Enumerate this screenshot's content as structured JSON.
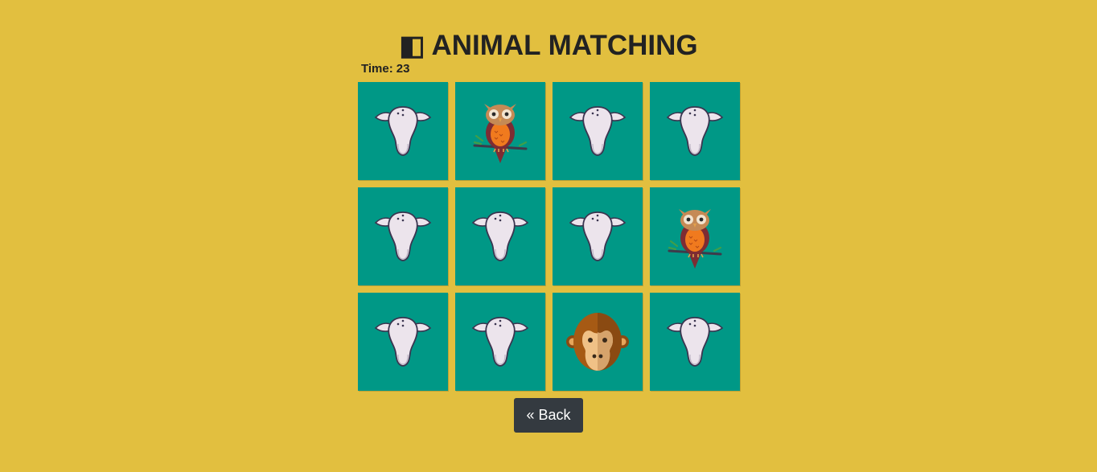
{
  "header": {
    "title": "ANIMAL MATCHING",
    "title_icon": "◧",
    "title_icon_name": "half-square-icon"
  },
  "timer": {
    "label": "Time:",
    "value": "23"
  },
  "board": {
    "columns": 4,
    "rows": 3,
    "card_color": "#009886",
    "cards": [
      {
        "state": "hidden",
        "face": "cow-skull"
      },
      {
        "state": "revealed",
        "face": "owl"
      },
      {
        "state": "hidden",
        "face": "cow-skull"
      },
      {
        "state": "hidden",
        "face": "cow-skull"
      },
      {
        "state": "hidden",
        "face": "cow-skull"
      },
      {
        "state": "hidden",
        "face": "cow-skull"
      },
      {
        "state": "hidden",
        "face": "cow-skull"
      },
      {
        "state": "revealed",
        "face": "owl"
      },
      {
        "state": "hidden",
        "face": "cow-skull"
      },
      {
        "state": "hidden",
        "face": "cow-skull"
      },
      {
        "state": "revealed",
        "face": "monkey"
      },
      {
        "state": "hidden",
        "face": "cow-skull"
      }
    ]
  },
  "back_button": {
    "label": "« Back"
  },
  "colors": {
    "background": "#e2bf3f",
    "button": "#343a40"
  }
}
